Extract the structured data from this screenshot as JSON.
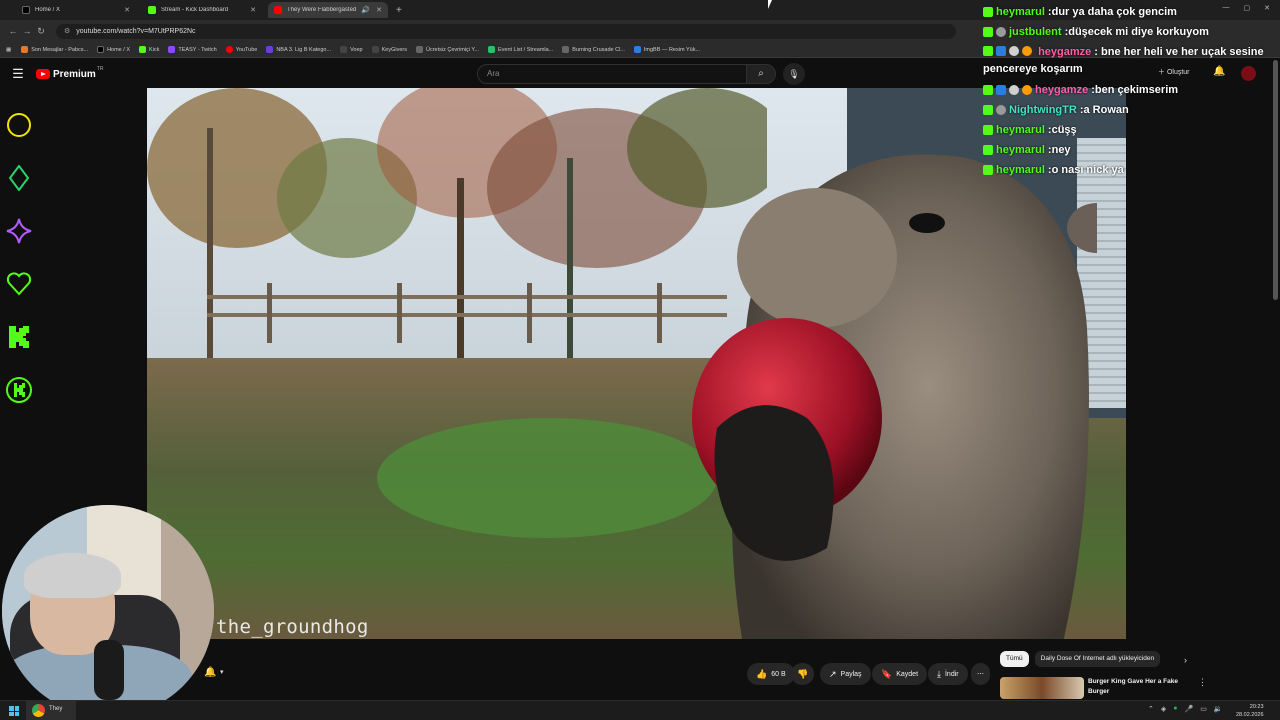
{
  "browser": {
    "tabs": [
      {
        "title": "Home / X",
        "color": "#000000",
        "active": false
      },
      {
        "title": "Stream - Kick Dashboard",
        "color": "#53fc18",
        "active": false
      },
      {
        "title": "They Were Flabbergasted",
        "color": "#ff0000",
        "active": true
      }
    ],
    "url": "youtube.com/watch?v=M7UtPRP62Nc",
    "bookmarks": [
      {
        "label": "Son Mesajlar - Pabcs...",
        "color": "#e07a2f"
      },
      {
        "label": "Home / X",
        "color": "#000000"
      },
      {
        "label": "Kick",
        "color": "#53fc18"
      },
      {
        "label": "TEASY - Twitch",
        "color": "#9146ff"
      },
      {
        "label": "YouTube",
        "color": "#ff0000"
      },
      {
        "label": "NBA 3. Lig B Katego...",
        "color": "#6a3fd8"
      },
      {
        "label": "Voep",
        "color": "#777777"
      },
      {
        "label": "KeyGivers",
        "color": "#777777"
      },
      {
        "label": "Ücretsiz Çevrimiçi Y...",
        "color": "#777777"
      },
      {
        "label": "Event List / Streamla...",
        "color": "#2bbf6a"
      },
      {
        "label": "Burning Crusade Cl...",
        "color": "#777777"
      },
      {
        "label": "ImgBB — Resim Yük...",
        "color": "#2a7de1"
      }
    ]
  },
  "youtube": {
    "brand": "Premium",
    "brand_suffix": "TR",
    "search_placeholder": "Ara",
    "create_label": "Oluştur",
    "video_watermark": "the_groundhog",
    "actions": {
      "like_count": "60 B",
      "share": "Paylaş",
      "save": "Kaydet",
      "download": "İndir"
    },
    "chips": [
      {
        "label": "Tümü",
        "selected": true
      },
      {
        "label": "Daily Dose Of Internet adlı yükleyiciden",
        "selected": false
      }
    ],
    "suggestion_title": "Burger King Gave Her a Fake Burger"
  },
  "chat": [
    {
      "user": "heymarul",
      "color": "green",
      "badges": [
        "kick"
      ],
      "text": "dur ya daha çok gencim"
    },
    {
      "user": "justbulent",
      "color": "green",
      "badges": [
        "kick",
        "gray"
      ],
      "text": "düşecek mi diye korkuyom"
    },
    {
      "user": "heygamze",
      "color": "pink",
      "badges": [
        "kick",
        "blue",
        "rocket",
        "orange"
      ],
      "text": "bne her heli ve her uçak sesine pencereye koşarım"
    },
    {
      "user": "heygamze",
      "color": "pink",
      "badges": [
        "kick",
        "blue",
        "rocket",
        "orange"
      ],
      "text": "ben çekimserim"
    },
    {
      "user": "NightwingTR",
      "color": "teal",
      "badges": [
        "kick",
        "gray"
      ],
      "text": "a Rowan"
    },
    {
      "user": "heymarul",
      "color": "green",
      "badges": [
        "kick"
      ],
      "text": "cüşş"
    },
    {
      "user": "heymarul",
      "color": "green",
      "badges": [
        "kick"
      ],
      "text": "ney"
    },
    {
      "user": "heymarul",
      "color": "green",
      "badges": [
        "kick"
      ],
      "text": "o nası nick ya"
    }
  ],
  "taskbar": {
    "app_label": "They",
    "time": "20:23",
    "date": "28.02.2026"
  },
  "colors": {
    "kick_green": "#53fc18",
    "yt_red": "#ff0000",
    "yt_bg": "#0f0f0f"
  }
}
